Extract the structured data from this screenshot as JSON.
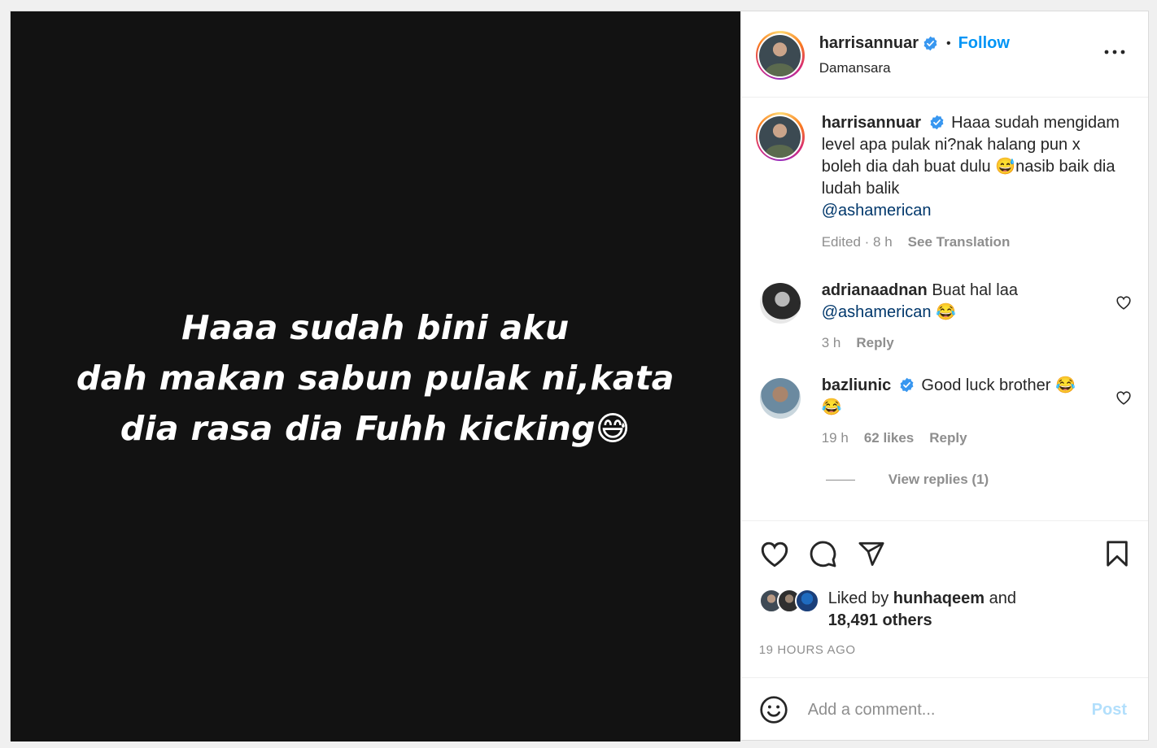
{
  "media": {
    "lines": [
      "Haaa sudah bini aku",
      "dah makan sabun pulak ni,kata",
      "dia rasa dia Fuhh kicking😅"
    ]
  },
  "header": {
    "username": "harrisannuar",
    "separator": "•",
    "follow_label": "Follow",
    "location": "Damansara",
    "more_icon": "more-horizontal-icon"
  },
  "caption": {
    "username": "harrisannuar",
    "text": "Haaa sudah mengidam level apa pulak ni?nak halang pun x boleh dia dah buat dulu 😅nasib baik dia ludah balik",
    "mention": "@ashamerican",
    "meta_time": "Edited · 8 h",
    "see_translation": "See Translation"
  },
  "comments": [
    {
      "username": "adrianaadnan",
      "text": "Buat hal laa",
      "mention": "@ashamerican",
      "emoji": "😂",
      "time": "3 h",
      "reply_label": "Reply"
    },
    {
      "username": "bazliunic",
      "text": "Good luck brother 😂",
      "emoji": "😂",
      "time": "19 h",
      "likes": "62 likes",
      "reply_label": "Reply",
      "view_replies": "View replies (1)"
    }
  ],
  "likes": {
    "prefix": "Liked by",
    "user": "hunhaqeem",
    "and": "and",
    "others": "18,491 others"
  },
  "time_ago": "19 HOURS AGO",
  "add_comment": {
    "placeholder": "Add a comment...",
    "post_label": "Post"
  },
  "colors": {
    "accent": "#0095f6",
    "post_disabled": "#b2dffc",
    "mention": "#00376b",
    "muted": "#8e8e8e"
  }
}
